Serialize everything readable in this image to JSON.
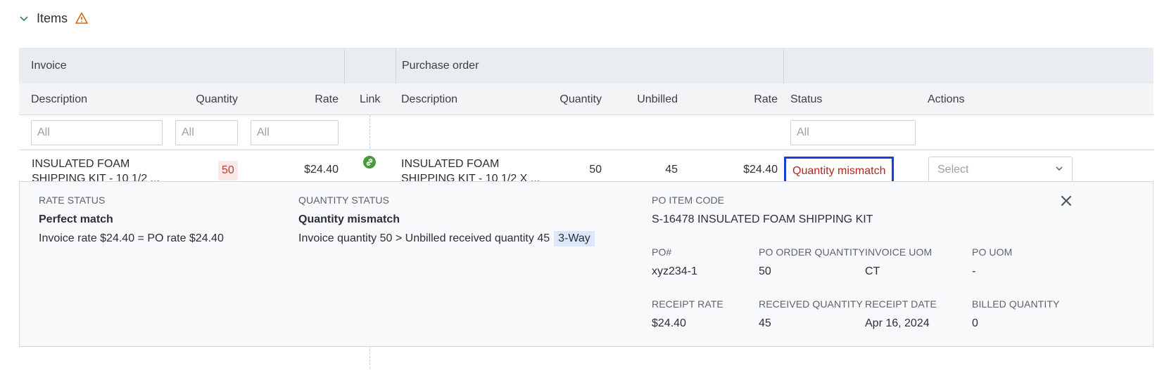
{
  "section": {
    "title": "Items",
    "collapse_icon": "chevron-down-icon",
    "warning_icon": "warning-icon"
  },
  "table": {
    "groups": {
      "invoice": "Invoice",
      "purchase_order": "Purchase order"
    },
    "columns": {
      "inv_description": "Description",
      "inv_quantity": "Quantity",
      "inv_rate": "Rate",
      "link": "Link",
      "po_description": "Description",
      "po_quantity": "Quantity",
      "po_unbilled": "Unbilled",
      "po_rate": "Rate",
      "status": "Status",
      "actions": "Actions"
    },
    "filters": {
      "inv_description": "All",
      "inv_quantity": "All",
      "inv_rate": "All",
      "status": "All"
    },
    "row": {
      "inv_description_line1": "INSULATED FOAM",
      "inv_description_line2": "SHIPPING KIT - 10 1/2 ...",
      "inv_quantity": "50",
      "inv_rate": "$24.40",
      "po_description_line1": "INSULATED FOAM",
      "po_description_line2": "SHIPPING KIT - 10 1/2 X ...",
      "po_quantity": "50",
      "po_unbilled": "45",
      "po_rate": "$24.40",
      "status": "Quantity mismatch",
      "action_placeholder": "Select"
    }
  },
  "detail": {
    "rate_status_label": "RATE STATUS",
    "rate_status_value": "Perfect match",
    "rate_status_text": "Invoice rate $24.40 = PO rate $24.40",
    "quantity_status_label": "QUANTITY STATUS",
    "quantity_status_value": "Quantity mismatch",
    "quantity_status_text": "Invoice quantity 50 > Unbilled received quantity 45",
    "quantity_status_tag": "3-Way",
    "po_item_code_label": "PO ITEM CODE",
    "po_item_code_value": "S-16478 INSULATED FOAM SHIPPING KIT",
    "fields": [
      {
        "label": "PO#",
        "value": "xyz234-1"
      },
      {
        "label": "PO ORDER QUANTITY",
        "value": "50"
      },
      {
        "label": "INVOICE UOM",
        "value": "CT"
      },
      {
        "label": "PO UOM",
        "value": "-"
      },
      {
        "label": "RECEIPT RATE",
        "value": "$24.40"
      },
      {
        "label": "RECEIVED QUANTITY",
        "value": "45"
      },
      {
        "label": "RECEIPT DATE",
        "value": "Apr 16, 2024"
      },
      {
        "label": "BILLED QUANTITY",
        "value": "0"
      }
    ]
  },
  "colors": {
    "accent_teal": "#2e7d6f",
    "warning_orange": "#d2691e",
    "mismatch_red": "#b3261e",
    "focus_blue": "#1a3fd6",
    "link_green": "#4a9a3a"
  }
}
